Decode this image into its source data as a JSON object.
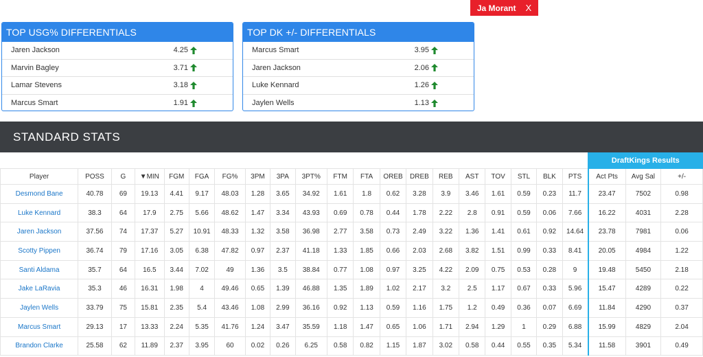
{
  "filter_tag": {
    "label": "Ja Morant",
    "close": "X"
  },
  "usg_card": {
    "title": "TOP USG% DIFFERENTIALS",
    "rows": [
      {
        "name": "Jaren Jackson",
        "value": "4.25"
      },
      {
        "name": "Marvin Bagley",
        "value": "3.71"
      },
      {
        "name": "Lamar Stevens",
        "value": "3.18"
      },
      {
        "name": "Marcus Smart",
        "value": "1.91"
      }
    ]
  },
  "dk_card": {
    "title": "TOP DK +/- DIFFERENTIALS",
    "rows": [
      {
        "name": "Marcus Smart",
        "value": "3.95"
      },
      {
        "name": "Jaren Jackson",
        "value": "2.06"
      },
      {
        "name": "Luke Kennard",
        "value": "1.26"
      },
      {
        "name": "Jaylen Wells",
        "value": "1.13"
      }
    ]
  },
  "standard_stats": {
    "title": "STANDARD STATS",
    "group_label": "DraftKings Results",
    "columns": [
      "Player",
      "POSS",
      "G",
      "▼MIN",
      "FGM",
      "FGA",
      "FG%",
      "3PM",
      "3PA",
      "3PT%",
      "FTM",
      "FTA",
      "OREB",
      "DREB",
      "REB",
      "AST",
      "TOV",
      "STL",
      "BLK",
      "PTS",
      "Act Pts",
      "Avg Sal",
      "+/-"
    ],
    "rows": [
      [
        "Desmond Bane",
        "40.78",
        "69",
        "19.13",
        "4.41",
        "9.17",
        "48.03",
        "1.28",
        "3.65",
        "34.92",
        "1.61",
        "1.8",
        "0.62",
        "3.28",
        "3.9",
        "3.46",
        "1.61",
        "0.59",
        "0.23",
        "11.7",
        "23.47",
        "7502",
        "0.98"
      ],
      [
        "Luke Kennard",
        "38.3",
        "64",
        "17.9",
        "2.75",
        "5.66",
        "48.62",
        "1.47",
        "3.34",
        "43.93",
        "0.69",
        "0.78",
        "0.44",
        "1.78",
        "2.22",
        "2.8",
        "0.91",
        "0.59",
        "0.06",
        "7.66",
        "16.22",
        "4031",
        "2.28"
      ],
      [
        "Jaren Jackson",
        "37.56",
        "74",
        "17.37",
        "5.27",
        "10.91",
        "48.33",
        "1.32",
        "3.58",
        "36.98",
        "2.77",
        "3.58",
        "0.73",
        "2.49",
        "3.22",
        "1.36",
        "1.41",
        "0.61",
        "0.92",
        "14.64",
        "23.78",
        "7981",
        "0.06"
      ],
      [
        "Scotty Pippen",
        "36.74",
        "79",
        "17.16",
        "3.05",
        "6.38",
        "47.82",
        "0.97",
        "2.37",
        "41.18",
        "1.33",
        "1.85",
        "0.66",
        "2.03",
        "2.68",
        "3.82",
        "1.51",
        "0.99",
        "0.33",
        "8.41",
        "20.05",
        "4984",
        "1.22"
      ],
      [
        "Santi Aldama",
        "35.7",
        "64",
        "16.5",
        "3.44",
        "7.02",
        "49",
        "1.36",
        "3.5",
        "38.84",
        "0.77",
        "1.08",
        "0.97",
        "3.25",
        "4.22",
        "2.09",
        "0.75",
        "0.53",
        "0.28",
        "9",
        "19.48",
        "5450",
        "2.18"
      ],
      [
        "Jake LaRavia",
        "35.3",
        "46",
        "16.31",
        "1.98",
        "4",
        "49.46",
        "0.65",
        "1.39",
        "46.88",
        "1.35",
        "1.89",
        "1.02",
        "2.17",
        "3.2",
        "2.5",
        "1.17",
        "0.67",
        "0.33",
        "5.96",
        "15.47",
        "4289",
        "0.22"
      ],
      [
        "Jaylen Wells",
        "33.79",
        "75",
        "15.81",
        "2.35",
        "5.4",
        "43.46",
        "1.08",
        "2.99",
        "36.16",
        "0.92",
        "1.13",
        "0.59",
        "1.16",
        "1.75",
        "1.2",
        "0.49",
        "0.36",
        "0.07",
        "6.69",
        "11.84",
        "4290",
        "0.37"
      ],
      [
        "Marcus Smart",
        "29.13",
        "17",
        "13.33",
        "2.24",
        "5.35",
        "41.76",
        "1.24",
        "3.47",
        "35.59",
        "1.18",
        "1.47",
        "0.65",
        "1.06",
        "1.71",
        "2.94",
        "1.29",
        "1",
        "0.29",
        "6.88",
        "15.99",
        "4829",
        "2.04"
      ],
      [
        "Brandon Clarke",
        "25.58",
        "62",
        "11.89",
        "2.37",
        "3.95",
        "60",
        "0.02",
        "0.26",
        "6.25",
        "0.58",
        "0.82",
        "1.15",
        "1.87",
        "3.02",
        "0.58",
        "0.44",
        "0.55",
        "0.35",
        "5.34",
        "11.58",
        "3901",
        "0.49"
      ]
    ]
  },
  "colors": {
    "card_blue": "#2f86e8",
    "dk_blue": "#28b0e8",
    "header_dark": "#3b3e42",
    "tag_red": "#e8202a",
    "arrow_green": "#1f8a2e",
    "link_blue": "#1a76c8"
  },
  "icons": {
    "trend": "arrow-up-icon"
  }
}
